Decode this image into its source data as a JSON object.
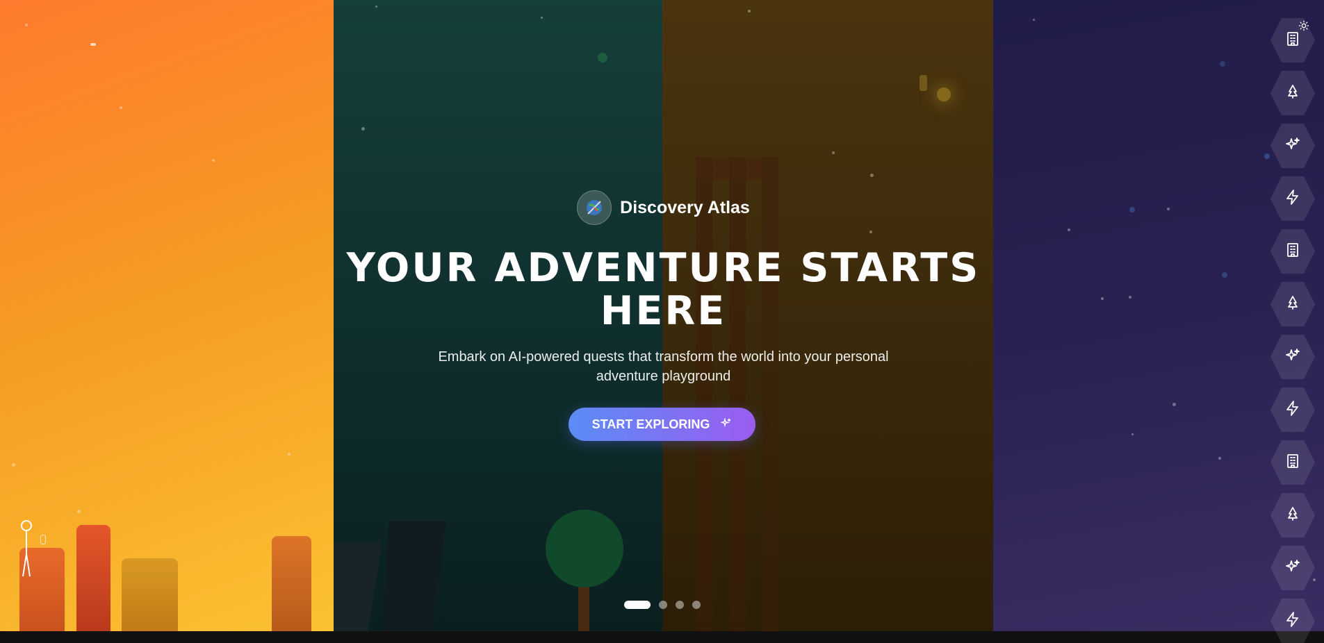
{
  "brand": {
    "name": "Discovery Atlas",
    "logo_icon": "compass-globe-icon"
  },
  "hero": {
    "headline": "YOUR ADVENTURE STARTS HERE",
    "subheadline": "Embark on AI-powered quests that transform the world into your personal adventure playground",
    "cta_label": "START EXPLORING",
    "cta_icon": "sparkle-icon"
  },
  "panels": [
    {
      "theme": "city",
      "colors": [
        "#ff7a2e",
        "#fbc133"
      ]
    },
    {
      "theme": "forest",
      "colors": [
        "#153f3a",
        "#0a1f20"
      ]
    },
    {
      "theme": "ruins",
      "colors": [
        "#4a340e",
        "#2c1e07"
      ]
    },
    {
      "theme": "space",
      "colors": [
        "#201c48",
        "#3a2c62"
      ]
    }
  ],
  "pager": {
    "count": 4,
    "active": 0
  },
  "rail": {
    "icons": [
      "building-icon",
      "tree-icon",
      "sparkles-icon",
      "lightning-icon",
      "building-icon",
      "tree-icon",
      "sparkles-icon",
      "lightning-icon",
      "building-icon",
      "tree-icon",
      "sparkles-icon",
      "lightning-icon"
    ]
  },
  "theme_toggle_icon": "sun-icon",
  "colors": {
    "cta_start": "#5b8cf5",
    "cta_end": "#9a5df0"
  }
}
